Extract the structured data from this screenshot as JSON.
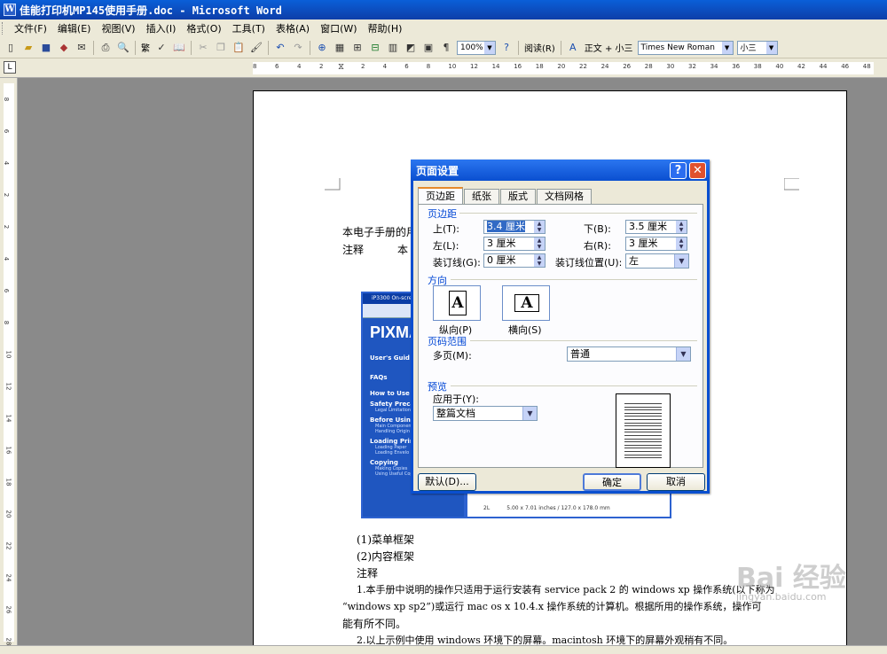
{
  "window": {
    "title": "佳能打印机MP145使用手册.doc - Microsoft Word",
    "icon_letter": "W"
  },
  "menu": [
    "文件(F)",
    "编辑(E)",
    "视图(V)",
    "插入(I)",
    "格式(O)",
    "工具(T)",
    "表格(A)",
    "窗口(W)",
    "帮助(H)"
  ],
  "toolbar": {
    "trad_simp": "繁",
    "zoom": "100%",
    "read_label": "阅读(R)",
    "style": "正文 + 小三",
    "font": "Times New Roman",
    "size": "小三"
  },
  "ruler": {
    "left_nums": [
      "8",
      "6",
      "4",
      "2"
    ],
    "right_nums": [
      "2",
      "4",
      "6",
      "8",
      "10",
      "12",
      "14",
      "16",
      "18",
      "20",
      "22",
      "24",
      "26",
      "28",
      "30",
      "32",
      "34",
      "36",
      "38",
      "40",
      "42",
      "44",
      "46",
      "48"
    ],
    "vertical_nums": [
      "8",
      "6",
      "4",
      "2",
      "2",
      "4",
      "6",
      "8",
      "10",
      "12",
      "14",
      "16",
      "18",
      "20",
      "22",
      "24",
      "26",
      "28"
    ]
  },
  "document": {
    "line1": "本电子手册的用",
    "line2_a": "注释",
    "line2_b": "本",
    "after": [
      "(1)菜单框架",
      "(2)内容框架",
      "注释",
      "1.本手册中说明的操作只适用于运行安装有 service pack 2 的 windows xp 操作系统(以下称为",
      "“windows xp sp2”)或运行 mac os x 10.4.x 操作系统的计算机。根据所用的操作系统，操作可",
      "能有所不同。",
      "2.以上示例中使用 windows 环境下的屏幕。macintosh 环境下的屏幕外观稍有不同。"
    ],
    "embedded_shot": {
      "window_title": "iP3300 On-screen",
      "pixma": "PIXMA",
      "guide": "User's Guid",
      "faq": "FAQs",
      "items": [
        {
          "title": "How to Use T",
          "subs": []
        },
        {
          "title": "Safety Precau",
          "subs": [
            "Legal Limitation"
          ]
        },
        {
          "title": "Before Using",
          "subs": [
            "Main Component",
            "Handling Origin"
          ]
        },
        {
          "title": "Loading Print",
          "subs": [
            "Loading Paper",
            "Loading Envelo"
          ]
        },
        {
          "title": "Copying",
          "subs": [
            "Making Copies",
            "Using Useful Copy Functions"
          ]
        }
      ],
      "size_row_a": "2L",
      "size_row_b": "5.00 x 7.01 inches / 127.0 x 178.0 mm"
    }
  },
  "dialog": {
    "title": "页面设置",
    "tabs": [
      "页边距",
      "纸张",
      "版式",
      "文档网格"
    ],
    "active_tab": 0,
    "margins_group": "页边距",
    "top_label": "上(T):",
    "top_value": "3.4 厘米",
    "bottom_label": "下(B):",
    "bottom_value": "3.5 厘米",
    "left_label": "左(L):",
    "left_value": "3 厘米",
    "right_label": "右(R):",
    "right_value": "3 厘米",
    "gutter_label": "装订线(G):",
    "gutter_value": "0 厘米",
    "gutter_pos_label": "装订线位置(U):",
    "gutter_pos_value": "左",
    "orientation_group": "方向",
    "portrait_label": "纵向(P)",
    "landscape_label": "横向(S)",
    "orientation_glyph": "A",
    "pages_group": "页码范围",
    "multi_pages_label": "多页(M):",
    "multi_pages_value": "普通",
    "preview_group": "预览",
    "apply_to_label": "应用于(Y):",
    "apply_to_value": "整篇文档",
    "default_btn": "默认(D)...",
    "ok_btn": "确定",
    "cancel_btn": "取消",
    "help_glyph": "?",
    "close_glyph": "✕"
  },
  "watermark": {
    "brand": "Bai 经验",
    "url": "jingyan.baidu.com"
  }
}
